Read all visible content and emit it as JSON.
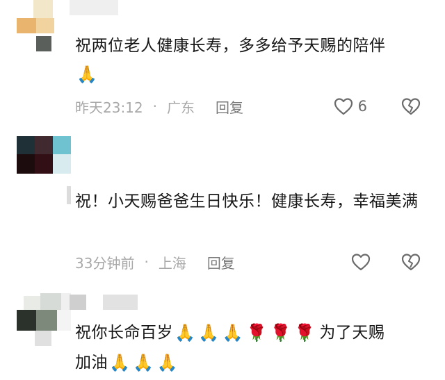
{
  "comments": [
    {
      "text": "祝两位老人健康长寿，多多给予天赐的陪伴",
      "emojis": [
        "🙏"
      ],
      "time": "昨天23:12",
      "dot": "·",
      "location": "广东",
      "reply_label": "回复",
      "like_count": "6"
    },
    {
      "text": "祝！小天赐爸爸生日快乐！健康长寿，幸福美满",
      "time": "33分钟前",
      "dot": "·",
      "location": "上海",
      "reply_label": "回复",
      "like_count": ""
    },
    {
      "text_part1": "祝你长命百岁",
      "emojis_a": [
        "🙏",
        "🙏",
        "🙏",
        "🌹",
        "🌹",
        "🌹"
      ],
      "text_part2": "为了天赐",
      "text_part3": "加油",
      "emojis_b": [
        "🙏",
        "🙏",
        "🙏"
      ]
    }
  ],
  "icons": [
    "heart-outline-icon",
    "broken-heart-icon",
    "folded-hands-emoji",
    "rose-emoji"
  ],
  "colors": {
    "text": "#161616",
    "meta": "#a8a8a8",
    "reply": "#7a7a7a",
    "icon": "#6b6b6b"
  }
}
